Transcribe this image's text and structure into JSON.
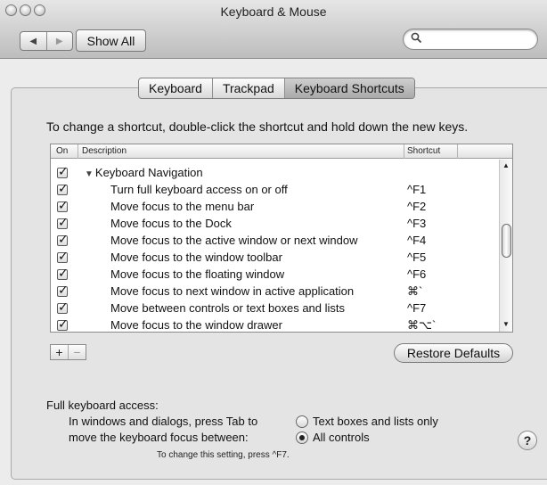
{
  "window": {
    "title": "Keyboard & Mouse"
  },
  "toolbar": {
    "back_glyph": "◀",
    "forward_glyph": "▶",
    "show_all_label": "Show All",
    "search_glyph": "🔍",
    "search_placeholder": ""
  },
  "tabs": [
    {
      "label": "Keyboard",
      "selected": false
    },
    {
      "label": "Trackpad",
      "selected": false
    },
    {
      "label": "Keyboard Shortcuts",
      "selected": true
    }
  ],
  "instructions": "To change a shortcut, double-click the shortcut and hold down the new keys.",
  "table": {
    "columns": {
      "on": "On",
      "description": "Description",
      "shortcut": "Shortcut"
    },
    "rows": [
      {
        "checked": true,
        "group": true,
        "expanded_glyph": "▼",
        "description": "Keyboard Navigation",
        "shortcut": ""
      },
      {
        "checked": true,
        "group": false,
        "description": "Turn full keyboard access on or off",
        "shortcut": "^F1"
      },
      {
        "checked": true,
        "group": false,
        "description": "Move focus to the menu bar",
        "shortcut": "^F2"
      },
      {
        "checked": true,
        "group": false,
        "description": "Move focus to the Dock",
        "shortcut": "^F3"
      },
      {
        "checked": true,
        "group": false,
        "description": "Move focus to the active window or next window",
        "shortcut": "^F4"
      },
      {
        "checked": true,
        "group": false,
        "description": "Move focus to the window toolbar",
        "shortcut": "^F5"
      },
      {
        "checked": true,
        "group": false,
        "description": "Move focus to the floating window",
        "shortcut": "^F6"
      },
      {
        "checked": true,
        "group": false,
        "description": "Move focus to next window in active application",
        "shortcut": "⌘`"
      },
      {
        "checked": true,
        "group": false,
        "description": "Move between controls or text boxes and lists",
        "shortcut": "^F7"
      },
      {
        "checked": true,
        "group": false,
        "description": "Move focus to the window drawer",
        "shortcut": "⌘⌥`"
      }
    ],
    "scroll_up_glyph": "▲",
    "scroll_down_glyph": "▼"
  },
  "buttons": {
    "add_label": "+",
    "remove_label": "−",
    "restore_defaults_label": "Restore Defaults",
    "help_label": "?"
  },
  "full_keyboard_access": {
    "title": "Full keyboard access:",
    "prompt_line1": "In windows and dialogs, press Tab to",
    "prompt_line2": "move the keyboard focus between:",
    "options": [
      {
        "label": "Text boxes and lists only",
        "selected": false
      },
      {
        "label": "All controls",
        "selected": true
      }
    ],
    "note": "To change this setting, press ^F7."
  }
}
